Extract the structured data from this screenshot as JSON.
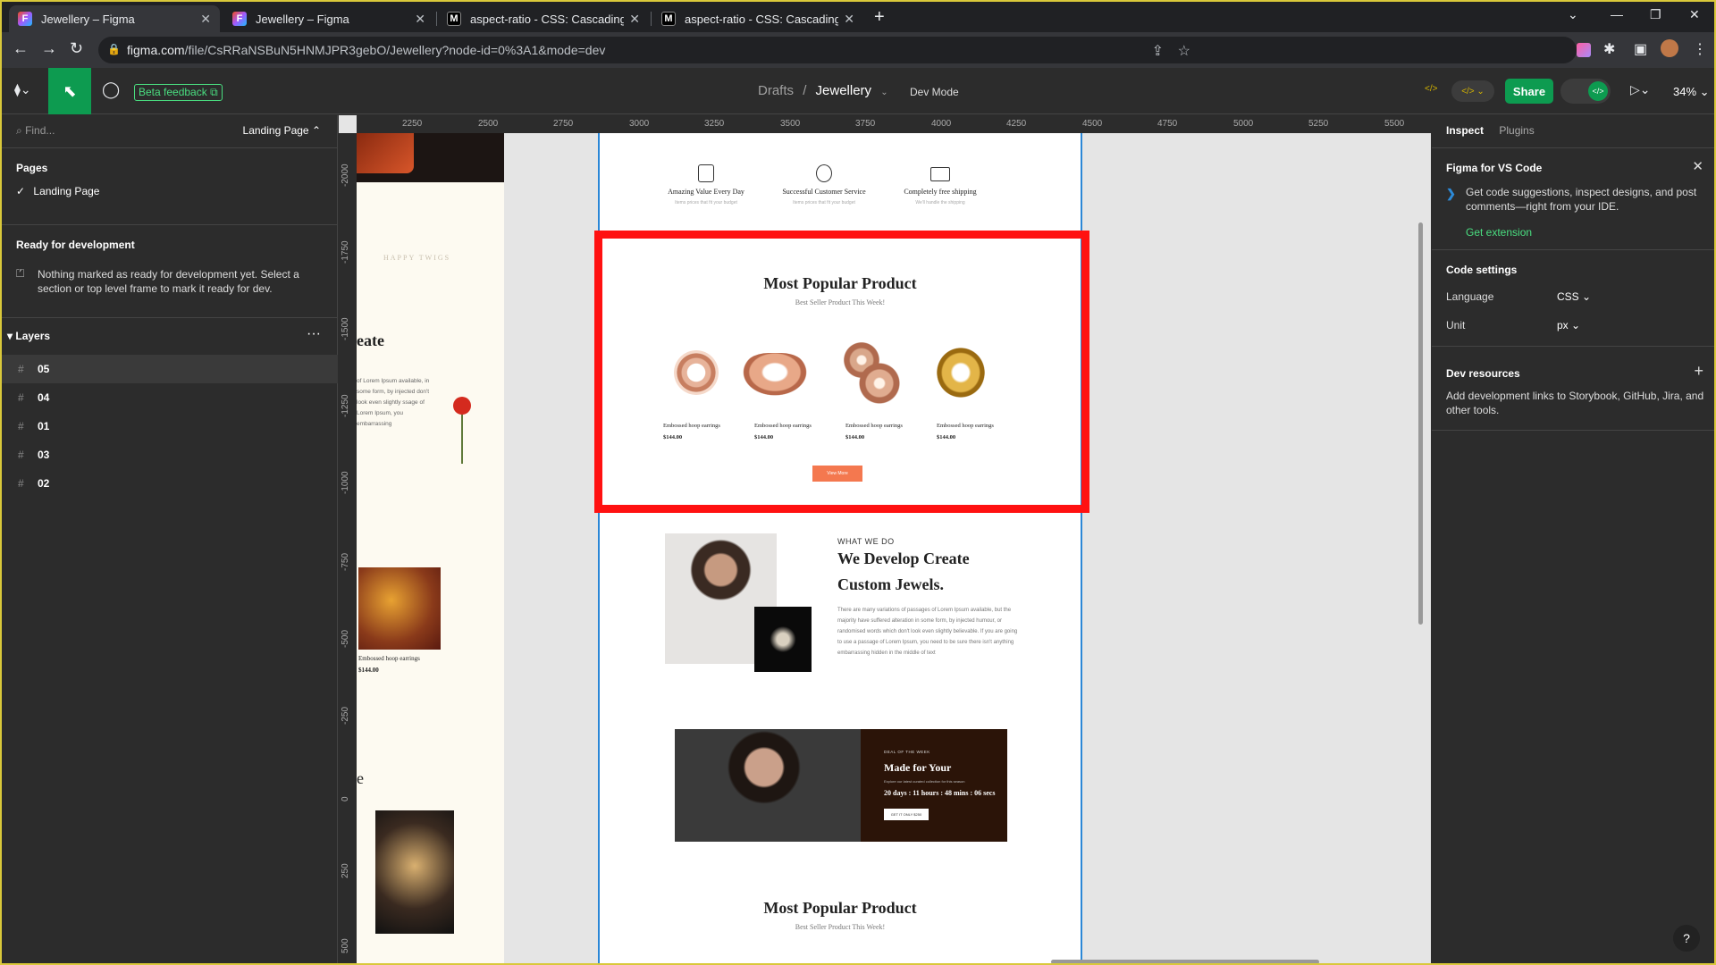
{
  "browser": {
    "tabs": [
      {
        "title": "Jewellery – Figma",
        "icon": "figma-icon"
      },
      {
        "title": "Jewellery – Figma",
        "icon": "figma-icon"
      },
      {
        "title": "aspect-ratio - CSS: Cascading St",
        "icon": "mdn-icon"
      },
      {
        "title": "aspect-ratio - CSS: Cascading St",
        "icon": "mdn-icon"
      }
    ],
    "url_host": "figma.com",
    "url_path": "/file/CsRRaNSBuN5HNMJPR3gebO/Jewellery?node-id=0%3A1&mode=dev"
  },
  "toolbar": {
    "beta_label": "Beta feedback",
    "breadcrumb_parent": "Drafts",
    "breadcrumb_sep": "/",
    "file_name": "Jewellery",
    "dev_mode": "Dev Mode",
    "share_label": "Share",
    "zoom": "34%"
  },
  "left_panel": {
    "find_placeholder": "Find...",
    "current_page": "Landing Page",
    "pages_heading": "Pages",
    "pages": [
      "Landing Page"
    ],
    "ready_heading": "Ready for development",
    "ready_text": "Nothing marked as ready for development yet. Select a section or top level frame to mark it ready for dev.",
    "layers_heading": "Layers",
    "layers": [
      "05",
      "04",
      "01",
      "03",
      "02"
    ]
  },
  "rulers": {
    "h": [
      "2250",
      "2500",
      "2750",
      "3000",
      "3250",
      "3500",
      "3750",
      "4000",
      "4250",
      "4500",
      "4750",
      "5000",
      "5250",
      "5500"
    ],
    "v": [
      "-2000",
      "-1750",
      "-1500",
      "-1250",
      "-1000",
      "-750",
      "-500",
      "-250",
      "0",
      "250",
      "500"
    ]
  },
  "design": {
    "left_frame": {
      "heading_fragment": "eate",
      "para": "of Lorem Ipsum available, in some form, by injected don't look even slightly ssage of Lorem Ipsum, you embarrassing",
      "brand": "HAPPY TWIGS",
      "product_name": "Embossed hoop earrings",
      "product_price": "$144.00",
      "fragment_e": "e"
    },
    "features": [
      {
        "title": "Amazing Value Every Day",
        "sub": "Items prices that fit your budget"
      },
      {
        "title": "Successful Customer Service",
        "sub": "Items prices that fit your budget"
      },
      {
        "title": "Completely free shipping",
        "sub": "We'll handle the shipping"
      }
    ],
    "popular": {
      "title": "Most Popular Product",
      "subtitle": "Best Seller Product This Week!",
      "products": [
        {
          "name": "Embossed hoop earrings",
          "price": "$144.00"
        },
        {
          "name": "Embossed hoop earrings",
          "price": "$144.00"
        },
        {
          "name": "Embossed hoop earrings",
          "price": "$144.00"
        },
        {
          "name": "Embossed hoop earrings",
          "price": "$144.00"
        }
      ],
      "button": "View More"
    },
    "what_we_do": {
      "eyebrow": "WHAT WE DO",
      "title_line1": "We Develop Create",
      "title_line2": "Custom Jewels.",
      "body": "There are many variations of passages of Lorem Ipsum available, but the majority have suffered alteration in some form, by injected humour, or randomised words which don't look even slightly believable. If you are going to use a passage of Lorem Ipsum, you need to be sure there isn't anything embarrassing hidden in the middle of text"
    },
    "deal": {
      "eyebrow": "DEAL OF THE WEEK",
      "title": "Made for Your",
      "desc": "Explore our latest curated collection for this season",
      "countdown": "20 days : 11 hours : 48 mins : 06 secs",
      "button": "GET IT ONLY $250"
    },
    "popular2": {
      "title": "Most Popular Product",
      "subtitle": "Best Seller Product This Week!"
    }
  },
  "right_panel": {
    "tabs": [
      "Inspect",
      "Plugins"
    ],
    "vscode_heading": "Figma for VS Code",
    "vscode_text": "Get code suggestions, inspect designs, and post comments—right from your IDE.",
    "vscode_link": "Get extension",
    "code_heading": "Code settings",
    "language_label": "Language",
    "language_value": "CSS",
    "unit_label": "Unit",
    "unit_value": "px",
    "dev_heading": "Dev resources",
    "dev_text": "Add development links to Storybook, GitHub, Jira, and other tools.",
    "help": "?"
  },
  "colors": {
    "figma_green": "#0d9b50",
    "selection_red": "#ff1111",
    "cta_orange": "#f4784f",
    "deal_bg": "#2b1408"
  }
}
